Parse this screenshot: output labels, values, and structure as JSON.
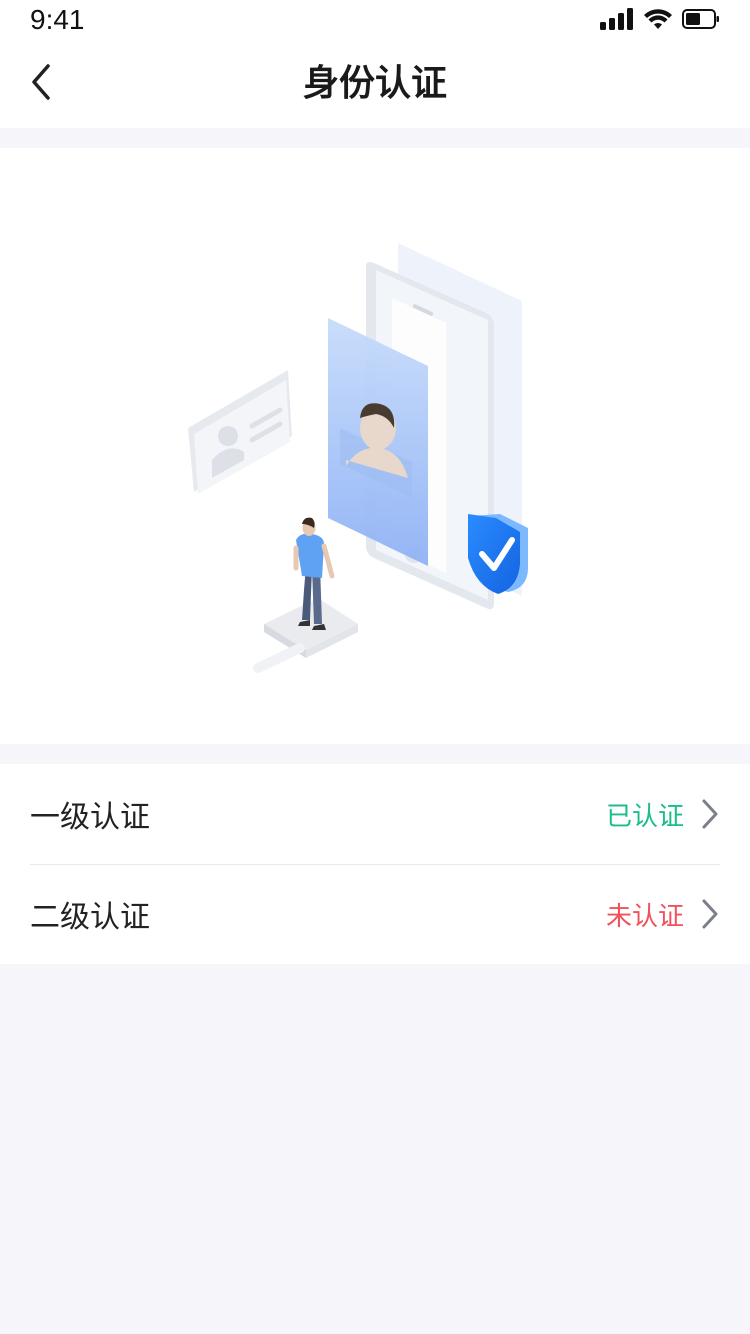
{
  "status_bar": {
    "time": "9:41",
    "icons": [
      "signal-icon",
      "wifi-icon",
      "battery-icon"
    ]
  },
  "nav": {
    "title": "身份认证",
    "back_icon": "chevron-left-icon"
  },
  "hero": {
    "illustration": "identity-verification-illustration"
  },
  "verification_list": [
    {
      "label": "一级认证",
      "status": "已认证",
      "status_color": "#19be8c"
    },
    {
      "label": "二级认证",
      "status": "未认证",
      "status_color": "#f0525b"
    }
  ],
  "colors": {
    "background": "#f5f5fa",
    "verified": "#19be8c",
    "unverified": "#f0525b",
    "shield_blue": "#1677f0"
  }
}
